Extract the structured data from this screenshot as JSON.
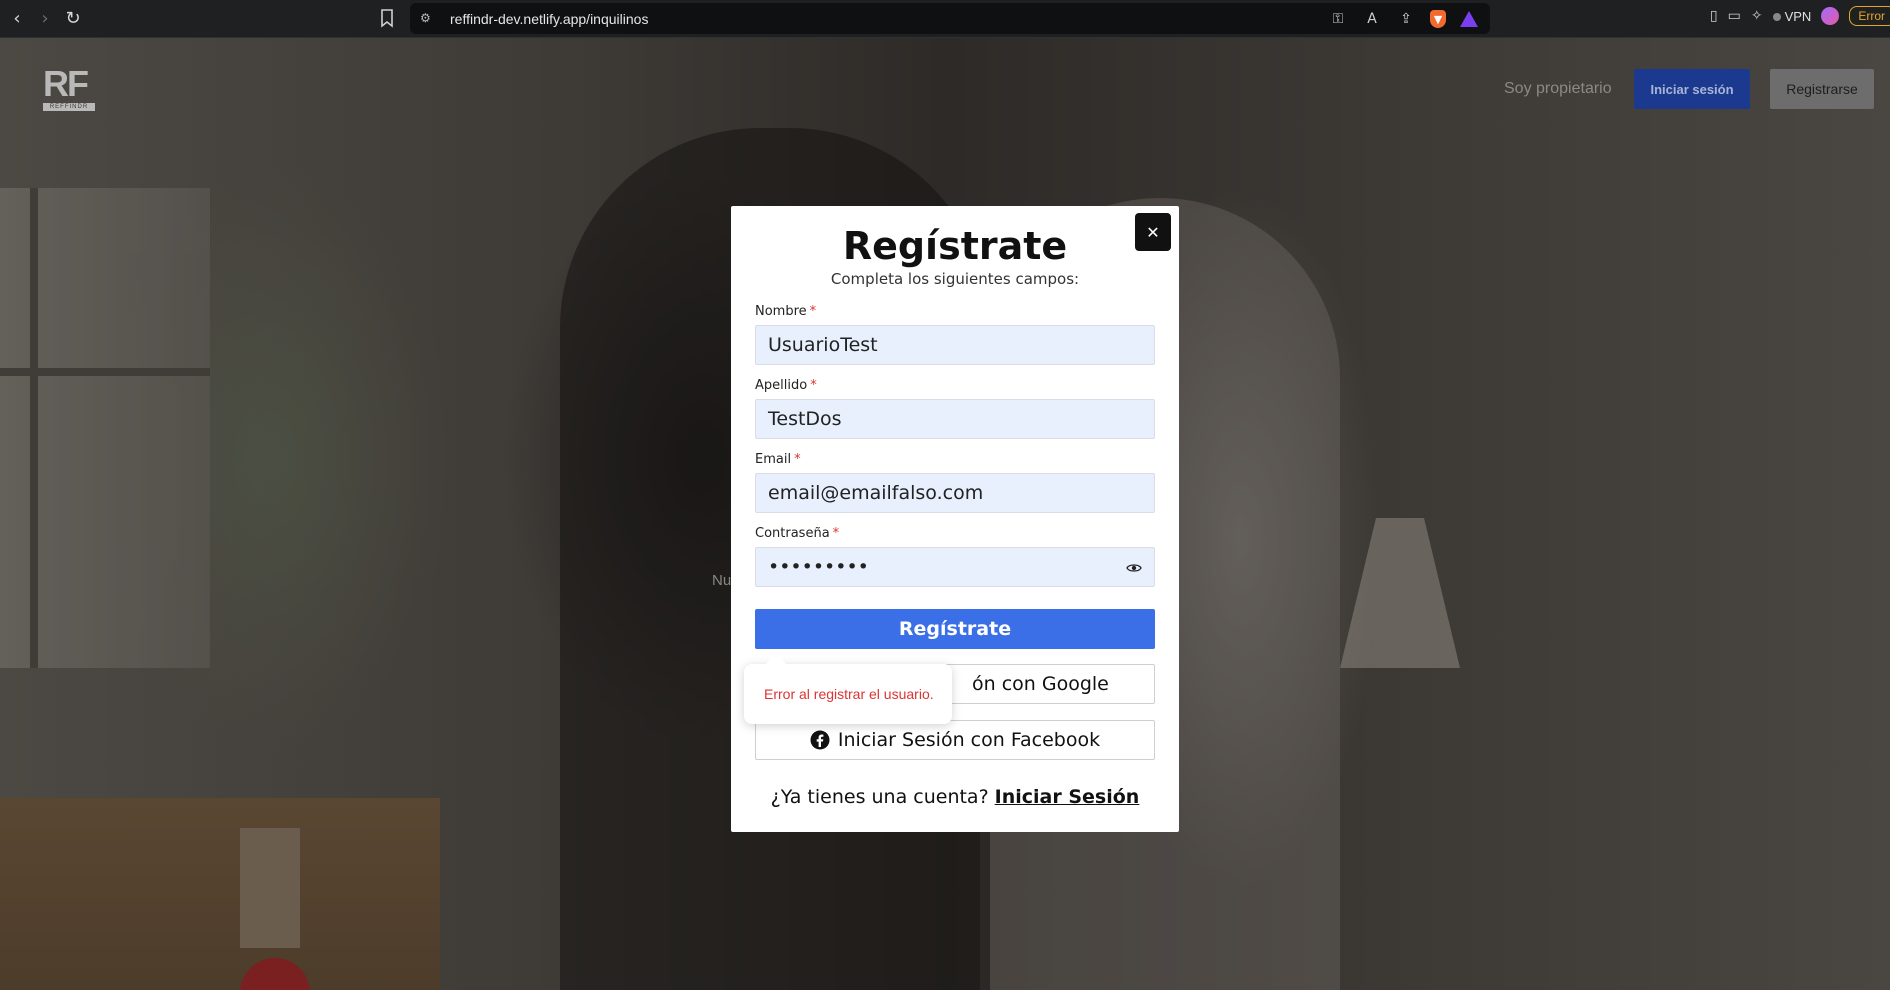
{
  "browser": {
    "url": "reffindr-dev.netlify.app/inquilinos",
    "vpn_label": "VPN",
    "error_label": "Error"
  },
  "site": {
    "logo_letters": "RF",
    "logo_sub": "REFFINDR",
    "nav_owner": "Soy propietario",
    "nav_login": "Iniciar sesión",
    "nav_register": "Registrarse",
    "background_text": "Nu"
  },
  "modal": {
    "title": "Regístrate",
    "subtitle": "Completa los siguientes campos:",
    "close_icon": "close-icon",
    "fields": {
      "nombre": {
        "label": "Nombre",
        "required": "*",
        "value": "UsuarioTest"
      },
      "apellido": {
        "label": "Apellido",
        "required": "*",
        "value": "TestDos"
      },
      "email": {
        "label": "Email",
        "required": "*",
        "value": "email@emailfalso.com"
      },
      "password": {
        "label": "Contraseña",
        "required": "*",
        "value": "•••••••••"
      }
    },
    "submit_label": "Regístrate",
    "google_label": "ón con Google",
    "facebook_label": "Iniciar Sesión con Facebook",
    "footer_question": "¿Ya tienes una cuenta?",
    "footer_link": "Iniciar Sesión"
  },
  "toast": {
    "message": "Error al registrar el usuario."
  },
  "colors": {
    "accent": "#3b6fe8",
    "login_button": "#1b3a8f",
    "error_text": "#dd3333",
    "input_bg": "#e8f0fe"
  }
}
